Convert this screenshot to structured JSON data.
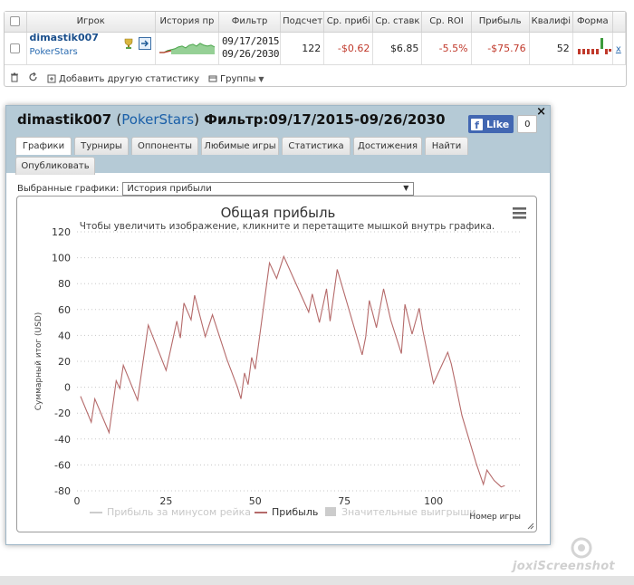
{
  "stats_table": {
    "columns": [
      "",
      "Игрок",
      "История пр",
      "Фильтр",
      "Подсчет",
      "Ср. прибі",
      "Ср. ставк",
      "Ср. ROI",
      "Прибыль",
      "Квалифі",
      "Форма",
      ""
    ],
    "row": {
      "player_name": "dimastik007",
      "player_site": "PokerStars",
      "filter_line1": "09/17/2015-",
      "filter_line2": "09/26/2030",
      "count": "122",
      "avg_profit": "-$0.62",
      "avg_stake": "$6.85",
      "avg_roi": "-5.5%",
      "profit": "-$75.76",
      "qualification": "52",
      "remove": "x"
    },
    "toolbar": {
      "add_stats": "Добавить другую статистику",
      "groups": "Группы"
    }
  },
  "window": {
    "title_player": "dimastik007",
    "title_site": "PokerStars",
    "title_open": "(",
    "title_close": ")",
    "title_filter": "Фильтр:09/17/2015-09/26/2030",
    "close": "×",
    "fb_like": "Like",
    "fb_count": "0",
    "tabs": [
      "Графики",
      "Турниры",
      "Оппоненты",
      "Любимые игры",
      "Статистика",
      "Достижения",
      "Найти",
      "Опубликовать"
    ],
    "active_tab": "Графики",
    "selected_label": "Выбранные графики:",
    "selected_value": "История прибыли"
  },
  "colors": {
    "profit_line": "#b56a6a",
    "legend_disabled": "#cccccc",
    "header_bg": "#b5cad6",
    "negative": "#c0392b"
  },
  "chart_data": {
    "type": "line",
    "title": "Общая прибыль",
    "subtitle": "Чтобы увеличить изображение, кликните и перетащите мышкой внутрь графика.",
    "xlabel": "Номер игры",
    "ylabel": "Суммарный итог (USD)",
    "ylim": [
      -80,
      120
    ],
    "xlim": [
      0,
      125
    ],
    "y_ticks": [
      -80,
      -60,
      -40,
      -20,
      0,
      20,
      40,
      60,
      80,
      100,
      120
    ],
    "x_ticks": [
      0,
      25,
      50,
      75,
      100
    ],
    "grid": "horizontal dashed",
    "legend": [
      "Прибыль за минусом рейка",
      "Прибыль",
      "Значительные выигрыши"
    ],
    "legend_placement": "bottom",
    "series": [
      {
        "name": "Прибыль",
        "x": [
          1,
          4,
          5,
          9,
          11,
          12,
          13,
          17,
          20,
          25,
          28,
          29,
          30,
          32,
          33,
          36,
          38,
          42,
          45,
          46,
          47,
          48,
          49,
          50,
          54,
          56,
          58,
          65,
          66,
          68,
          70,
          71,
          73,
          80,
          81,
          82,
          84,
          86,
          88,
          91,
          92,
          94,
          96,
          97,
          100,
          104,
          105,
          106,
          108,
          112,
          114,
          115,
          117,
          119,
          120
        ],
        "y": [
          -7,
          -27,
          -9,
          -35,
          5,
          -1,
          17,
          -10,
          48,
          13,
          51,
          38,
          65,
          52,
          71,
          39,
          56,
          22,
          0,
          -9,
          11,
          2,
          23,
          14,
          96,
          84,
          101,
          58,
          72,
          50,
          76,
          51,
          91,
          25,
          39,
          67,
          46,
          76,
          52,
          26,
          64,
          41,
          61,
          44,
          3,
          27,
          18,
          5,
          -22,
          -59,
          -75,
          -64,
          -72,
          -77,
          -76
        ]
      }
    ]
  }
}
